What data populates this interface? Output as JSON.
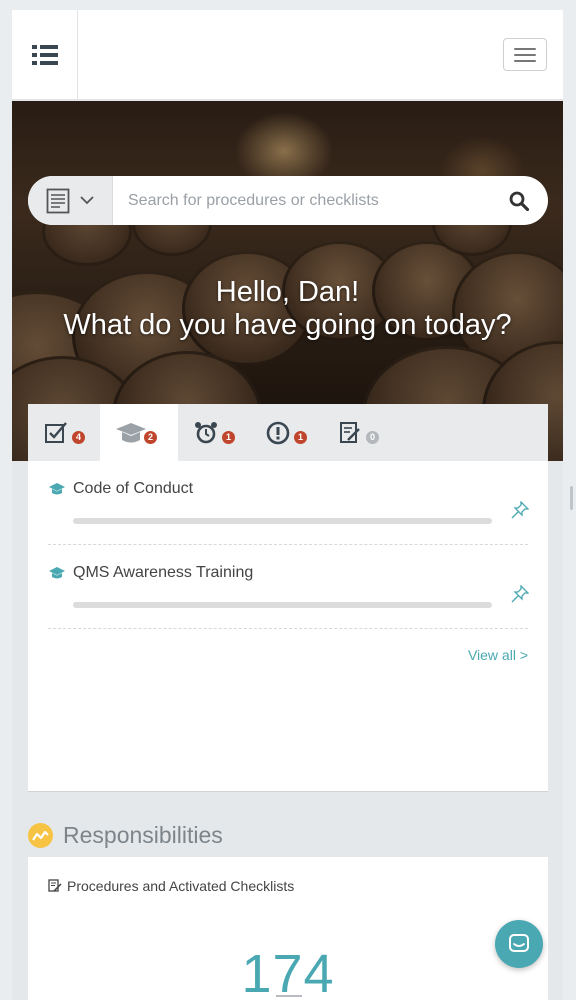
{
  "header": {
    "menu_icon": "list-icon",
    "toggle_icon": "hamburger-icon"
  },
  "search": {
    "type_icon": "document-icon",
    "placeholder": "Search for procedures or checklists",
    "button_icon": "search-icon"
  },
  "greeting": {
    "line1": "Hello, Dan!",
    "line2": "What do you have going on today?"
  },
  "tabs": [
    {
      "icon": "checkbox-icon",
      "count": "4",
      "active": false
    },
    {
      "icon": "graduation-cap-icon",
      "count": "2",
      "active": true
    },
    {
      "icon": "alarm-clock-icon",
      "count": "1",
      "active": false
    },
    {
      "icon": "exclamation-circle-icon",
      "count": "1",
      "active": false
    },
    {
      "icon": "edit-document-icon",
      "count": "0",
      "active": false
    }
  ],
  "trainings": {
    "items": [
      {
        "title": "Code of Conduct",
        "progress": 0
      },
      {
        "title": "QMS Awareness Training",
        "progress": 0
      }
    ],
    "view_all": "View all >"
  },
  "responsibilities": {
    "title": "Responsibilities",
    "card_title": "Procedures and Activated Checklists",
    "count": "174"
  },
  "colors": {
    "accent": "#4aa8b2",
    "badge": "#c0452d",
    "responsibility_icon": "#f6c343"
  }
}
